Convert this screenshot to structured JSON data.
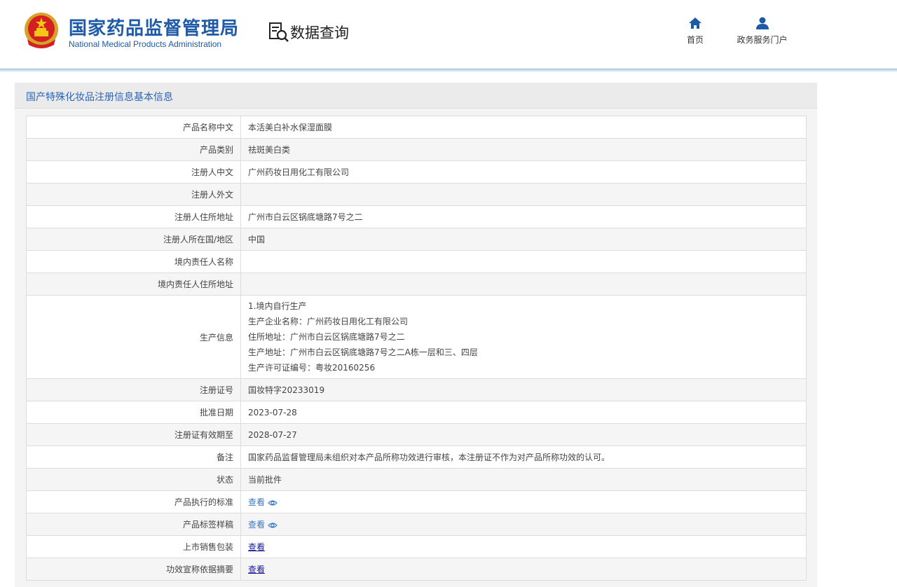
{
  "header": {
    "org_cn": "国家药品监督管理局",
    "org_en": "National Medical Products Administration",
    "query_title": "数据查询",
    "nav": [
      {
        "label": "首页",
        "icon": "home-icon"
      },
      {
        "label": "政务服务门户",
        "icon": "user-icon"
      }
    ]
  },
  "colors": {
    "brand": "#1d5aa8",
    "link": "#3a78c3",
    "panel_title": "#2c65b5"
  },
  "panel": {
    "title": "国产特殊化妆品注册信息基本信息"
  },
  "rows": {
    "product_name_cn": {
      "label": "产品名称中文",
      "value": "本活美白补水保湿面膜"
    },
    "product_category": {
      "label": "产品类别",
      "value": "祛斑美白类"
    },
    "registrant_cn": {
      "label": "注册人中文",
      "value": "广州药妆日用化工有限公司"
    },
    "registrant_foreign": {
      "label": "注册人外文",
      "value": ""
    },
    "registrant_address": {
      "label": "注册人住所地址",
      "value": "广州市白云区锅底塘路7号之二"
    },
    "registrant_country": {
      "label": "注册人所在国/地区",
      "value": "中国"
    },
    "domestic_agent_name": {
      "label": "境内责任人名称",
      "value": ""
    },
    "domestic_agent_address": {
      "label": "境内责任人住所地址",
      "value": ""
    },
    "production_info": {
      "label": "生产信息",
      "lines": [
        "1.境内自行生产",
        "生产企业名称：广州药妆日用化工有限公司",
        "住所地址：广州市白云区锅底塘路7号之二",
        "生产地址：广州市白云区锅底塘路7号之二A栋一层和三、四层",
        "生产许可证编号：粤妆20160256"
      ]
    },
    "registration_no": {
      "label": "注册证号",
      "value": "国妆特字20233019"
    },
    "approval_date": {
      "label": "批准日期",
      "value": "2023-07-28"
    },
    "valid_until": {
      "label": "注册证有效期至",
      "value": "2028-07-27"
    },
    "remarks": {
      "label": "备注",
      "value": "国家药品监督管理局未组织对本产品所称功效进行审核，本注册证不作为对产品所称功效的认可。"
    },
    "status": {
      "label": "状态",
      "value": "当前批件"
    },
    "product_standard": {
      "label": "产品执行的标准",
      "link": "查看"
    },
    "label_sample": {
      "label": "产品标签样稿",
      "link": "查看"
    },
    "sales_package": {
      "label": "上市销售包装",
      "link": "查看"
    },
    "efficacy_summary": {
      "label": "功效宣称依据摘要",
      "link": "查看"
    }
  }
}
